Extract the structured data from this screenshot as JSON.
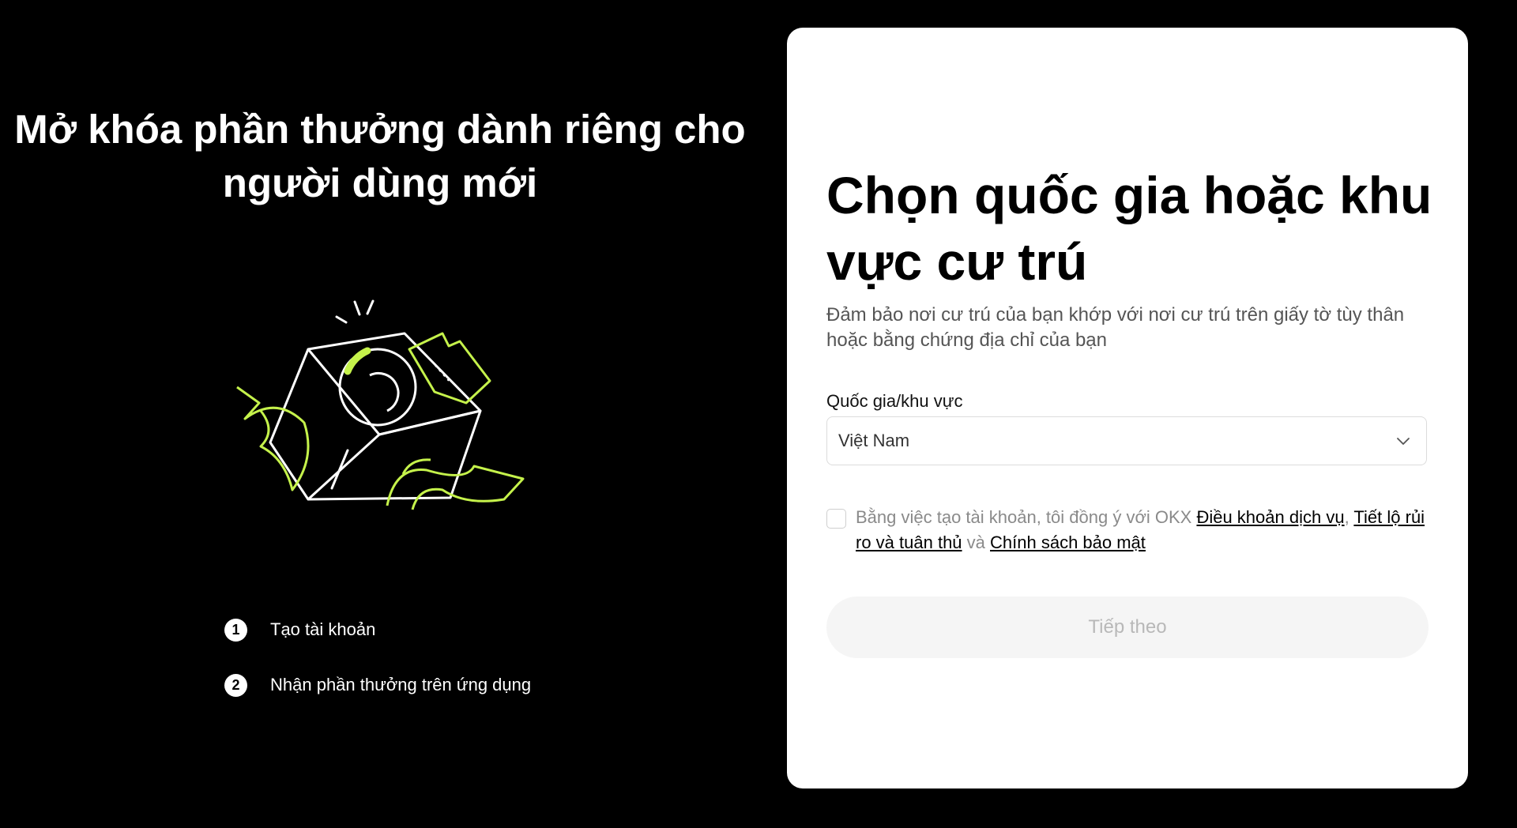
{
  "promo": {
    "title_line1": "Mở khóa phần thưởng dành riêng cho",
    "title_line2": "người dùng mới",
    "steps": [
      {
        "number": "1",
        "label": "Tạo tài khoản"
      },
      {
        "number": "2",
        "label": "Nhận phần thưởng trên ứng dụng"
      }
    ]
  },
  "form": {
    "title": "Chọn quốc gia hoặc khu vực cư trú",
    "subtitle": "Đảm bảo nơi cư trú của bạn khớp với nơi cư trú trên giấy tờ tùy thân hoặc bằng chứng địa chỉ của bạn",
    "country_label": "Quốc gia/khu vực",
    "country_value": "Việt Nam",
    "consent": {
      "prefix": "Bằng việc tạo tài khoản, tôi đồng ý với OKX ",
      "terms_link": "Điều khoản dịch vụ",
      "sep1": ", ",
      "risk_link": "Tiết lộ rủi ro và tuân thủ",
      "and": " và ",
      "privacy_link": "Chính sách bảo mật"
    },
    "next_button": "Tiếp theo"
  },
  "colors": {
    "background": "#000000",
    "card": "#ffffff",
    "accent": "#c5f24b",
    "button_disabled_bg": "#f5f5f5",
    "button_disabled_text": "#b8b8b8"
  },
  "icons": {
    "gift_illustration": "gift-box-illustration",
    "dropdown": "chevron-down-icon"
  }
}
